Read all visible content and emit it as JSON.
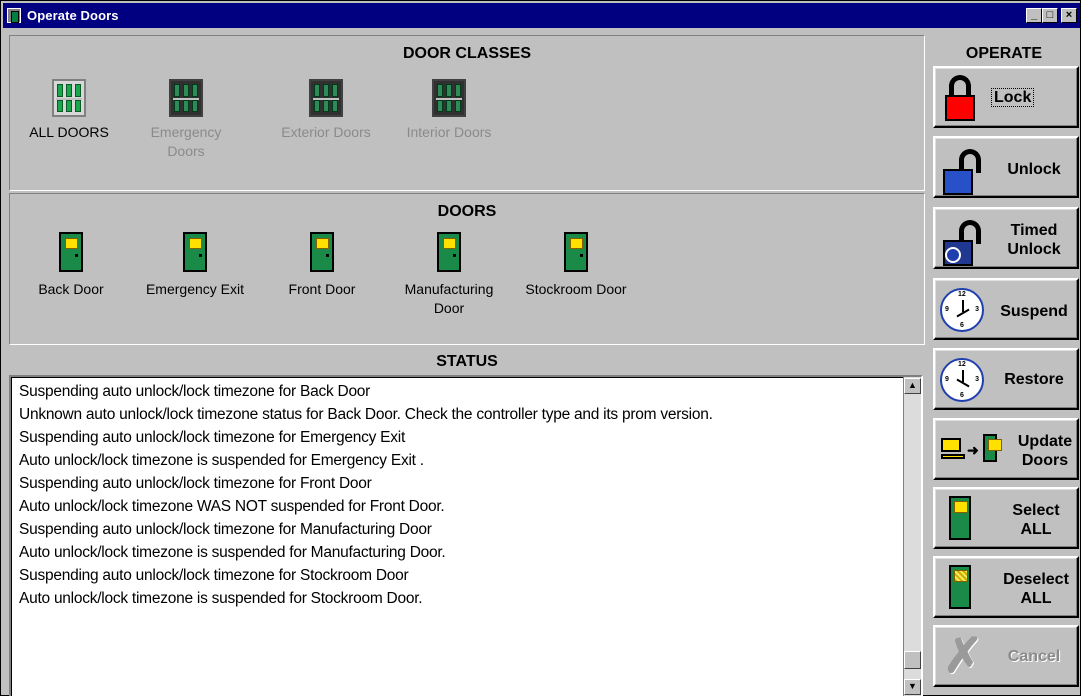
{
  "window": {
    "title": "Operate Doors",
    "buttons": {
      "minimize": "_",
      "maximize": "□",
      "close": "×"
    }
  },
  "door_classes": {
    "title": "DOOR CLASSES",
    "items": [
      {
        "label": "ALL DOORS",
        "enabled": true
      },
      {
        "label": "Emergency Doors",
        "enabled": false
      },
      {
        "label": "Exterior Doors",
        "enabled": false
      },
      {
        "label": "Interior Doors",
        "enabled": false
      }
    ]
  },
  "doors": {
    "title": "DOORS",
    "items": [
      {
        "label": "Back Door"
      },
      {
        "label": "Emergency Exit"
      },
      {
        "label": "Front Door"
      },
      {
        "label": "Manufacturing Door"
      },
      {
        "label": "Stockroom Door"
      }
    ]
  },
  "status": {
    "title": "STATUS",
    "lines": [
      "Suspending auto unlock/lock timezone for Back Door",
      "Unknown auto unlock/lock timezone status for Back Door. Check the controller type and its prom version.",
      "Suspending auto unlock/lock timezone for Emergency Exit",
      "Auto unlock/lock timezone is suspended for Emergency Exit .",
      "Suspending auto unlock/lock timezone for Front Door",
      "Auto unlock/lock timezone WAS NOT suspended for Front Door.",
      "Suspending auto unlock/lock timezone for Manufacturing Door",
      "Auto unlock/lock timezone is suspended for Manufacturing Door.",
      "Suspending auto unlock/lock timezone for Stockroom Door",
      "Auto unlock/lock timezone is suspended for Stockroom Door."
    ]
  },
  "operate": {
    "title": "OPERATE",
    "buttons": [
      {
        "line1": "Lock",
        "line2": "",
        "icon": "padlock-closed-icon",
        "enabled": true
      },
      {
        "line1": "Unlock",
        "line2": "",
        "icon": "padlock-open-icon",
        "enabled": true
      },
      {
        "line1": "Timed",
        "line2": "Unlock",
        "icon": "timed-unlock-icon",
        "enabled": true
      },
      {
        "line1": "Suspend",
        "line2": "",
        "icon": "clock-icon",
        "enabled": true
      },
      {
        "line1": "Restore",
        "line2": "",
        "icon": "clock-icon",
        "enabled": true
      },
      {
        "line1": "Update",
        "line2": "Doors",
        "icon": "computer-to-door-icon",
        "enabled": true
      },
      {
        "line1": "Select",
        "line2": "ALL",
        "icon": "door-icon",
        "enabled": true
      },
      {
        "line1": "Deselect",
        "line2": "ALL",
        "icon": "door-icon",
        "enabled": true
      },
      {
        "line1": "Cancel",
        "line2": "",
        "icon": "x-icon",
        "enabled": false
      }
    ]
  },
  "scrollbar": {
    "up": "▲",
    "down": "▼"
  },
  "colors": {
    "titlebar": "#000080",
    "face": "#c0c0c0",
    "door_green": "#1a8a48",
    "door_window": "#ffe000",
    "lock_red": "#ff0000",
    "unlock_blue": "#2850c8"
  }
}
